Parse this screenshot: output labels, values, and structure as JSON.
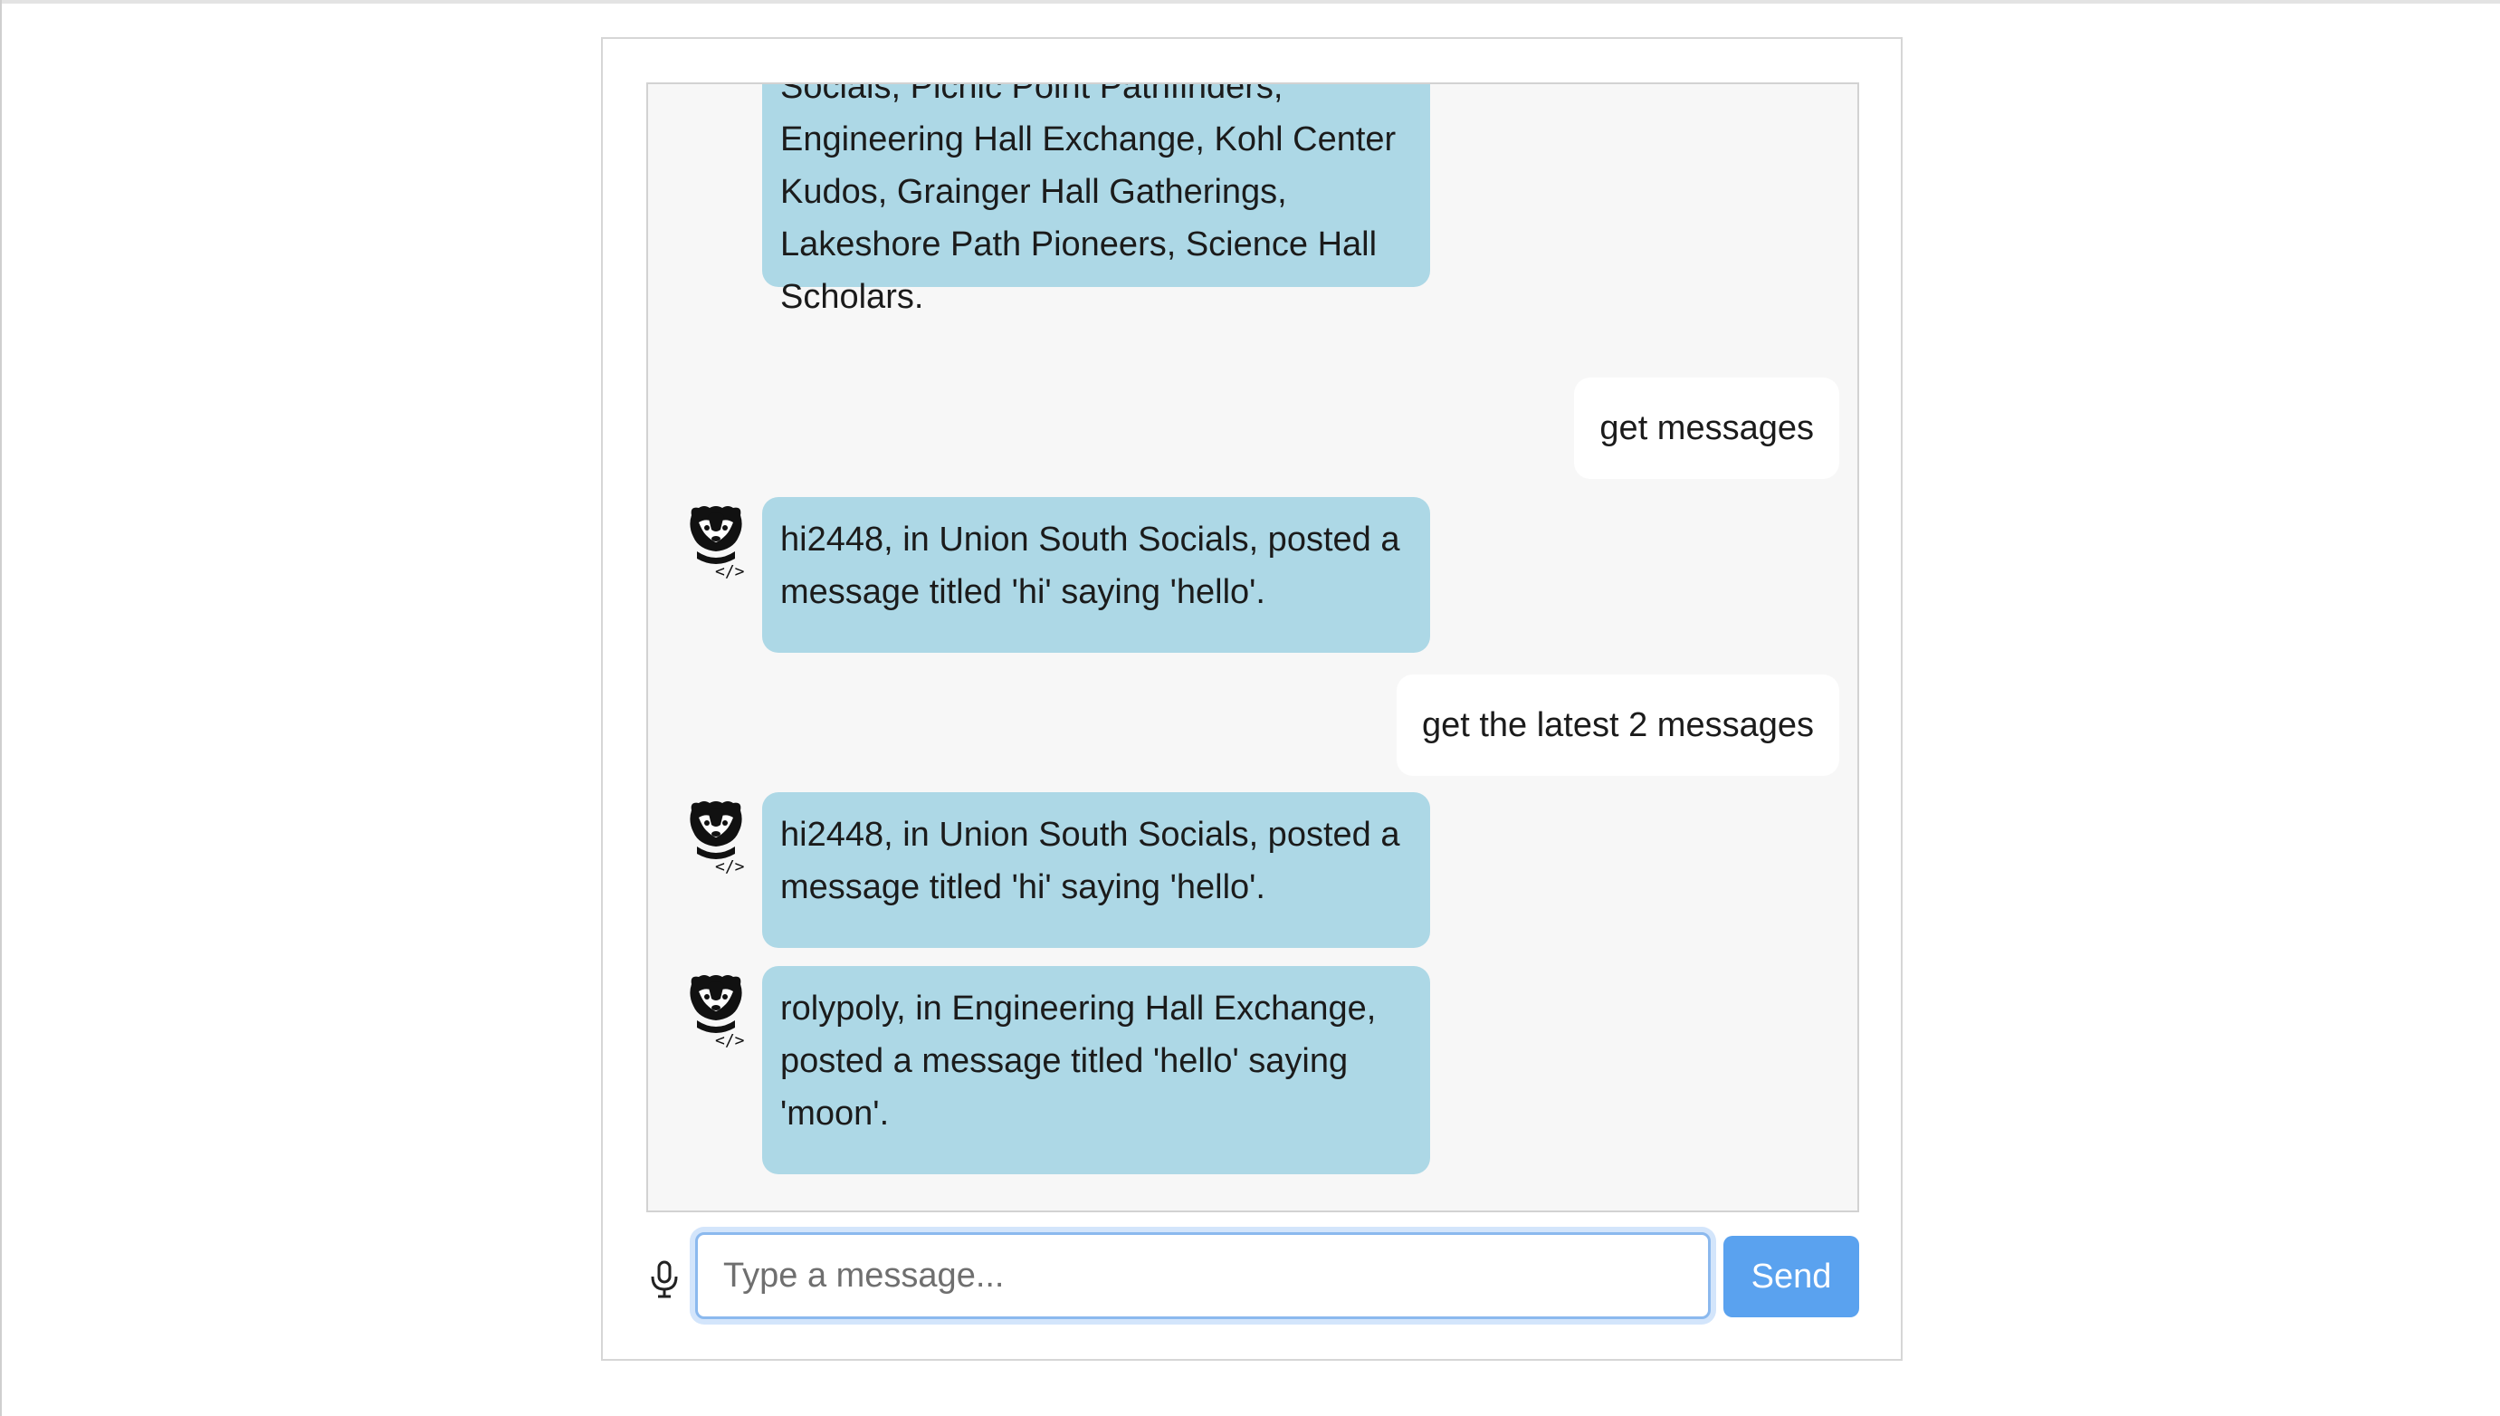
{
  "messages": [
    {
      "role": "assistant",
      "text_lines": [
        "Socials, Picnic Point Pathfinders,",
        "Engineering Hall Exchange, Kohl Center",
        "Kudos, Grainger Hall Gatherings,",
        "Lakeshore Path Pioneers, Science Hall",
        "Scholars."
      ]
    },
    {
      "role": "user",
      "text": "get messages"
    },
    {
      "role": "assistant",
      "text_lines": [
        "hi2448, in Union South Socials, posted a",
        "message titled 'hi' saying 'hello'."
      ]
    },
    {
      "role": "user",
      "text": "get the latest 2 messages"
    },
    {
      "role": "assistant",
      "text_lines": [
        "hi2448, in Union South Socials, posted a",
        "message titled 'hi' saying 'hello'."
      ]
    },
    {
      "role": "assistant",
      "text_lines": [
        "rolypoly, in Engineering Hall Exchange,",
        "posted a message titled 'hello' saying",
        "'moon'."
      ]
    }
  ],
  "avatar_icon": "badger-coder-icon",
  "composer": {
    "placeholder": "Type a message...",
    "value": "",
    "send_label": "Send",
    "mic_icon": "microphone-icon"
  },
  "colors": {
    "bot_bubble": "#add8e6",
    "user_bubble": "#ffffff",
    "send_button": "#5aa2ef",
    "chat_background": "#f7f7f7"
  }
}
